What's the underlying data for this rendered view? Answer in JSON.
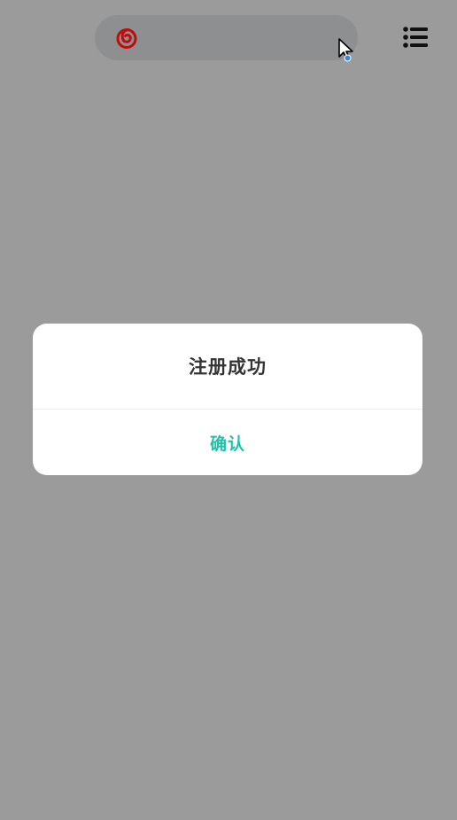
{
  "header": {
    "logo_icon": "netease-music-logo-icon",
    "menu_icon": "list-menu-icon",
    "logo_color": "#c20c0c"
  },
  "dialog": {
    "title": "注册成功",
    "confirm_label": "确认",
    "confirm_color": "#22c2a8"
  }
}
